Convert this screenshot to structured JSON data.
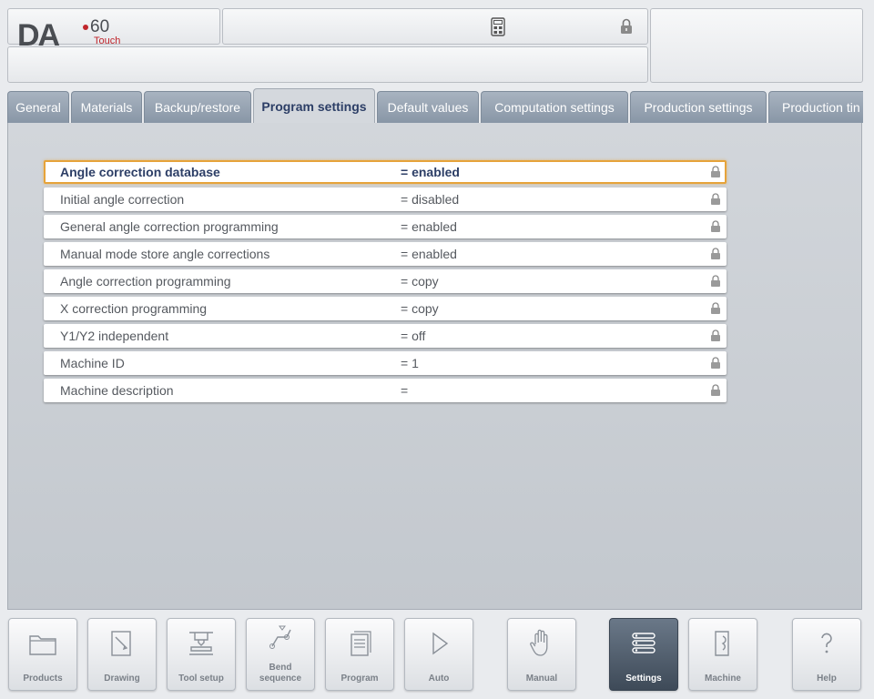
{
  "logo": {
    "brand": "DA",
    "model": "60",
    "variant": "Touch"
  },
  "tabs": [
    {
      "label": "General"
    },
    {
      "label": "Materials"
    },
    {
      "label": "Backup/restore"
    },
    {
      "label": "Program settings",
      "active": true
    },
    {
      "label": "Default values"
    },
    {
      "label": "Computation settings"
    },
    {
      "label": "Production settings"
    },
    {
      "label": "Production tin"
    }
  ],
  "settings": [
    {
      "label": "Angle correction database",
      "value": "=  enabled",
      "selected": true
    },
    {
      "label": "Initial angle correction",
      "value": "=  disabled"
    },
    {
      "label": "General angle correction programming",
      "value": "=  enabled"
    },
    {
      "label": "Manual mode store angle corrections",
      "value": "=  enabled"
    },
    {
      "label": "Angle correction programming",
      "value": "=  copy"
    },
    {
      "label": "X correction programming",
      "value": "=  copy"
    },
    {
      "label": "Y1/Y2 independent",
      "value": "=  off"
    },
    {
      "label": "Machine ID",
      "value": "=  1"
    },
    {
      "label": "Machine description",
      "value": "="
    }
  ],
  "nav": {
    "products": "Products",
    "drawing": "Drawing",
    "tool_setup": "Tool setup",
    "bend_sequence_1": "Bend",
    "bend_sequence_2": "sequence",
    "program": "Program",
    "auto": "Auto",
    "manual": "Manual",
    "settings": "Settings",
    "machine": "Machine",
    "help": "Help"
  },
  "colors": {
    "accent_selected": "#e6a33a",
    "tab_active_text": "#2c3e66",
    "logo_red": "#c0262c"
  }
}
